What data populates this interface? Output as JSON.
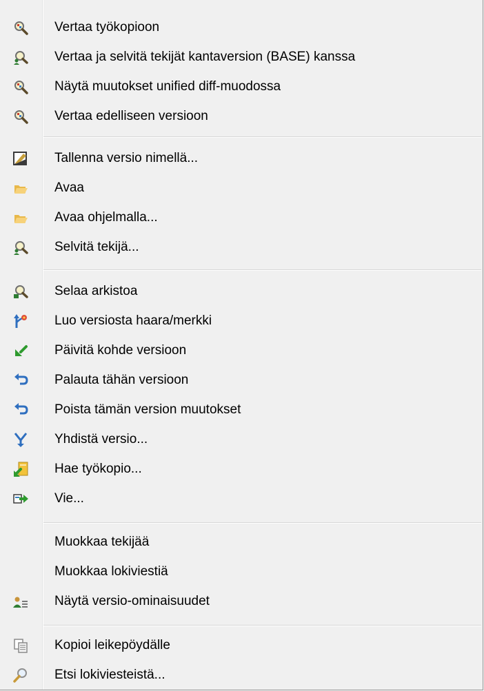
{
  "menu": {
    "items": [
      {
        "label": "Vertaa työkopioon",
        "icon": "compare-magnifier-icon"
      },
      {
        "label": "Vertaa ja selvitä tekijät kantaversion (BASE) kanssa",
        "icon": "blame-compare-icon"
      },
      {
        "label": "Näytä muutokset unified diff-muodossa",
        "icon": "unified-diff-magnifier-icon"
      },
      {
        "label": "Vertaa edelliseen versioon",
        "icon": "compare-previous-magnifier-icon"
      },
      {
        "label": "Tallenna versio nimellä...",
        "icon": "save-revision-icon"
      },
      {
        "label": "Avaa",
        "icon": "open-folder-icon"
      },
      {
        "label": "Avaa ohjelmalla...",
        "icon": "open-with-folder-icon"
      },
      {
        "label": "Selvitä tekijä...",
        "icon": "blame-icon"
      },
      {
        "label": "Selaa arkistoa",
        "icon": "repo-browser-icon"
      },
      {
        "label": "Luo versiosta haara/merkki",
        "icon": "branch-tag-icon"
      },
      {
        "label": "Päivitä kohde versioon",
        "icon": "update-to-revision-icon"
      },
      {
        "label": "Palauta tähän versioon",
        "icon": "revert-to-revision-icon"
      },
      {
        "label": "Poista tämän version muutokset",
        "icon": "revert-changes-icon"
      },
      {
        "label": "Yhdistä versio...",
        "icon": "merge-icon"
      },
      {
        "label": "Hae työkopio...",
        "icon": "checkout-icon"
      },
      {
        "label": "Vie...",
        "icon": "export-icon"
      },
      {
        "label": "Muokkaa tekijää",
        "icon": ""
      },
      {
        "label": "Muokkaa lokiviestiä",
        "icon": ""
      },
      {
        "label": "Näytä versio-ominaisuudet",
        "icon": "revision-properties-icon"
      },
      {
        "label": "Kopioi leikepöydälle",
        "icon": "copy-clipboard-icon"
      },
      {
        "label": "Etsi lokiviesteistä...",
        "icon": "search-log-icon"
      }
    ]
  },
  "colors": {
    "menu_background": "#f0f0f0",
    "border": "#979797",
    "separator": "#d7d7d7"
  }
}
